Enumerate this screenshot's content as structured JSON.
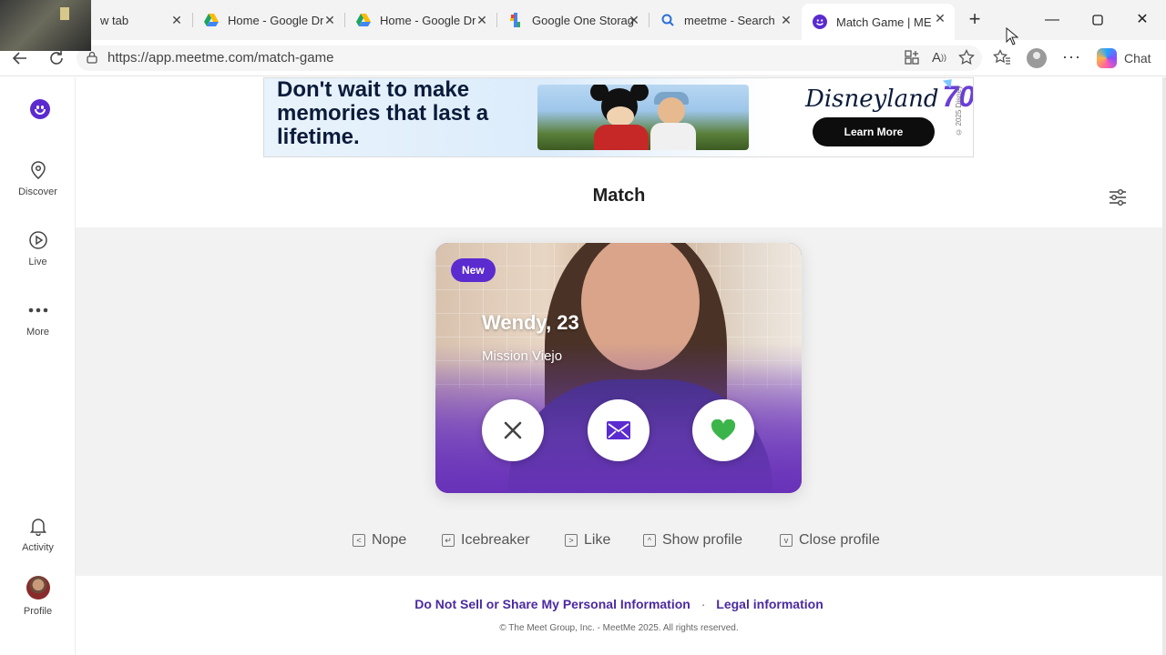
{
  "browser": {
    "tabs": [
      {
        "title": "w tab",
        "icon": "edge-newtab-icon"
      },
      {
        "title": "Home - Google Dr",
        "icon": "google-drive-icon"
      },
      {
        "title": "Home - Google Dr",
        "icon": "google-drive-icon"
      },
      {
        "title": "Google One Storag",
        "icon": "google-one-icon"
      },
      {
        "title": "meetme - Search",
        "icon": "search-icon"
      },
      {
        "title": "Match Game | ME",
        "icon": "meetme-icon",
        "active": true
      }
    ],
    "url": "https://app.meetme.com/match-game",
    "chat_label": "Chat"
  },
  "sidebar": {
    "items": [
      {
        "label": "Discover",
        "icon": "location-pin-icon"
      },
      {
        "label": "Live",
        "icon": "play-circle-icon"
      },
      {
        "label": "More",
        "icon": "more-dots-icon"
      },
      {
        "label": "Activity",
        "icon": "bell-icon"
      },
      {
        "label": "Profile",
        "icon": "avatar"
      }
    ]
  },
  "ad": {
    "headline": "Don't wait to make memories that last a lifetime.",
    "brand": "Disneyland",
    "brand_number": "70",
    "cta": "Learn More",
    "copyright": "© 2025 Disney"
  },
  "main": {
    "title": "Match"
  },
  "card": {
    "badge": "New",
    "name": "Wendy, 23",
    "location": "Mission Viejo"
  },
  "shortcuts": [
    {
      "label": "Nope",
      "key": "<"
    },
    {
      "label": "Icebreaker",
      "key": "↵"
    },
    {
      "label": "Like",
      "key": ">"
    },
    {
      "label": "Show profile",
      "key": "^"
    },
    {
      "label": "Close profile",
      "key": "v"
    }
  ],
  "footer": {
    "link1": "Do Not Sell or Share My Personal Information",
    "separator": "·",
    "link2": "Legal information",
    "copyright": "© The Meet Group, Inc. - MeetMe 2025. All rights reserved."
  },
  "colors": {
    "brand_purple": "#5b2bd0",
    "like_green": "#3bb54a",
    "link_purple": "#4b2aa0"
  }
}
